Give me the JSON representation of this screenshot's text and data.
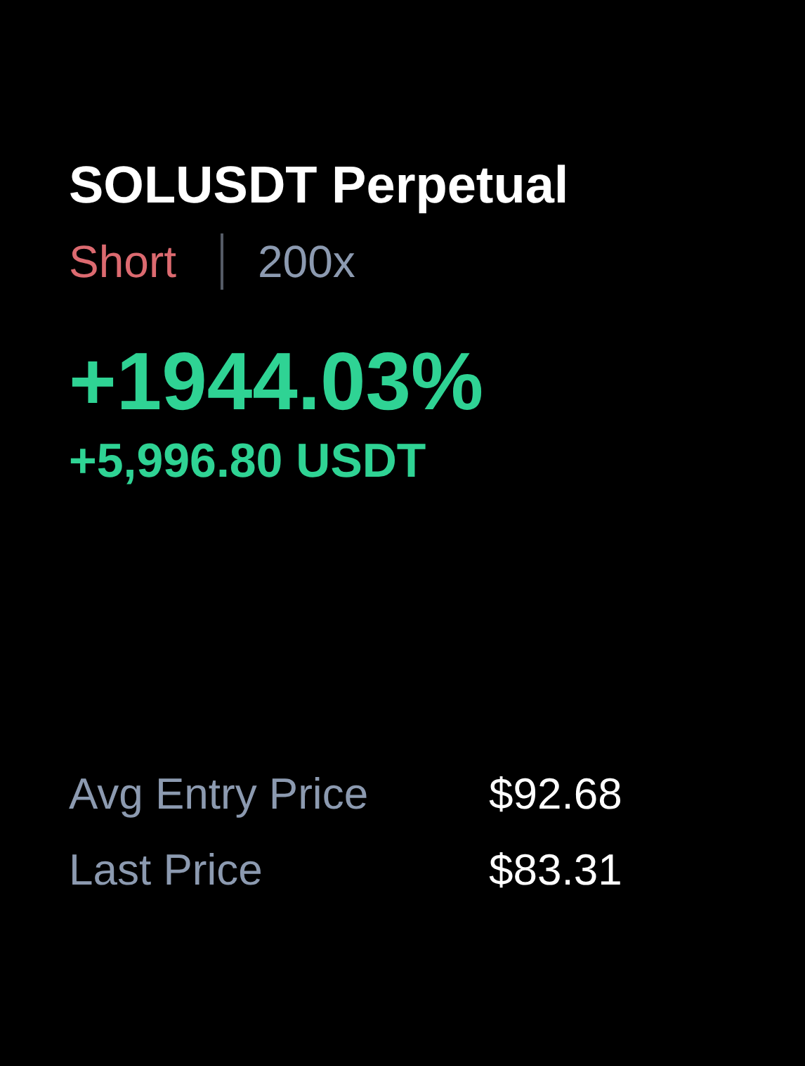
{
  "title": "SOLUSDT Perpetual",
  "position": {
    "side": "Short",
    "kind": "short",
    "leverage": "200x"
  },
  "pnl": {
    "percent": "+1944.03%",
    "amount": "+5,996.80 USDT",
    "kind": "profit"
  },
  "details": [
    {
      "label": "Avg Entry Price",
      "value": "$92.68"
    },
    {
      "label": "Last Price",
      "value": "$83.31"
    }
  ]
}
